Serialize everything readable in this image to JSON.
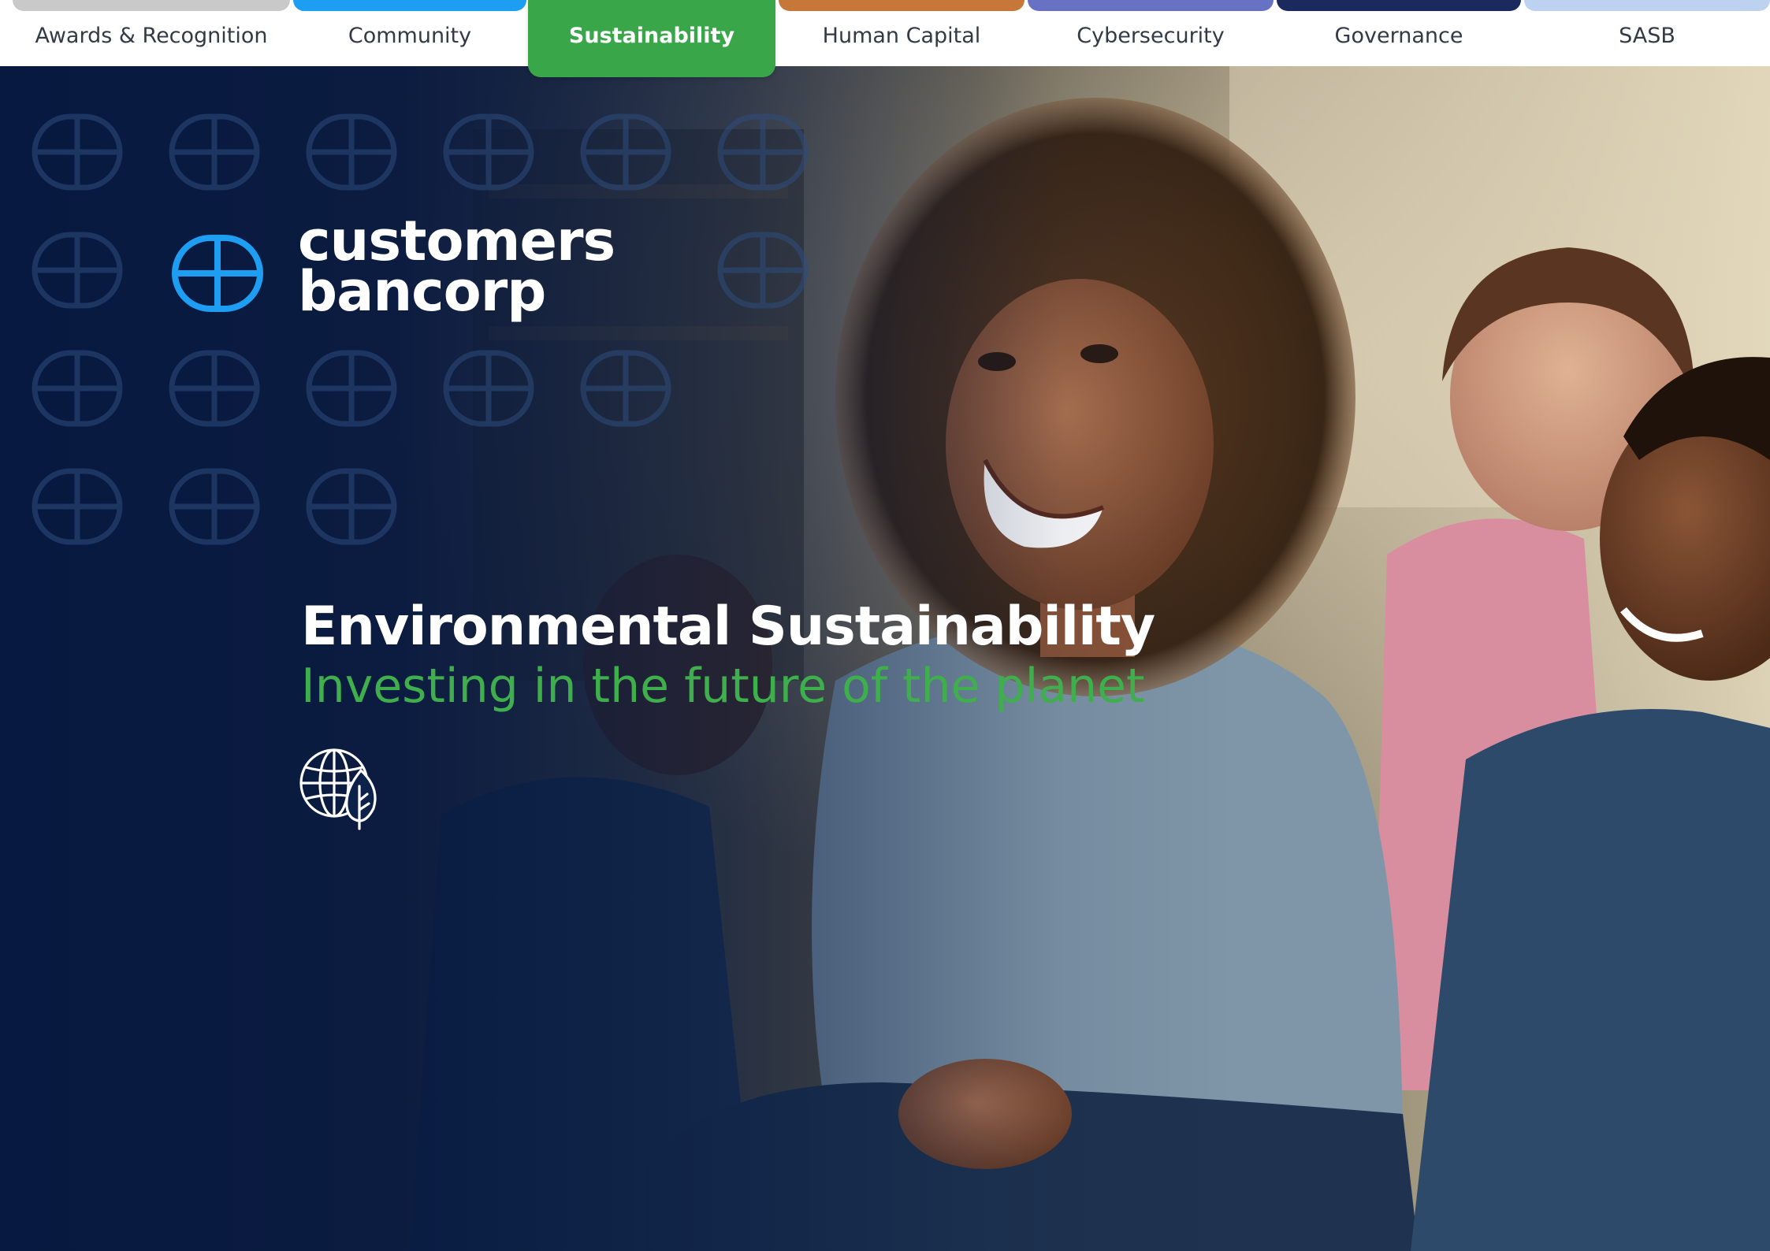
{
  "nav": {
    "tabs": [
      {
        "label": "Awards & Recognition",
        "color": "#c9c9c9"
      },
      {
        "label": "Community",
        "color": "#1e9ef2"
      },
      {
        "label": "Sustainability",
        "color": "#3aa64a",
        "active": true
      },
      {
        "label": "Human Capital",
        "color": "#c8773a"
      },
      {
        "label": "Cybersecurity",
        "color": "#6872c4"
      },
      {
        "label": "Governance",
        "color": "#1b2a5c"
      },
      {
        "label": "SASB",
        "color": "#bdd2f0"
      }
    ]
  },
  "brand": {
    "line1": "customers",
    "line2": "bancorp",
    "accent": "#1e9ef2"
  },
  "hero": {
    "headline": "Environmental Sustainability",
    "subhead": "Investing in the future of the planet",
    "icon": "globe-leaf-icon"
  },
  "colors": {
    "navy": "#0a1f44",
    "green": "#3fae4c",
    "blue": "#1e9ef2"
  }
}
